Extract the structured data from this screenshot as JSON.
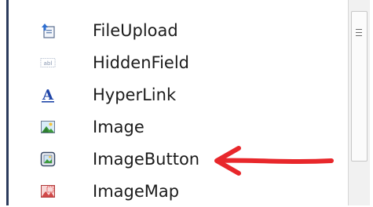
{
  "toolbox": {
    "items": [
      {
        "label": "FileUpload",
        "icon": "file-upload-icon"
      },
      {
        "label": "HiddenField",
        "icon": "hidden-field-icon"
      },
      {
        "label": "HyperLink",
        "icon": "hyperlink-icon"
      },
      {
        "label": "Image",
        "icon": "image-icon"
      },
      {
        "label": "ImageButton",
        "icon": "image-button-icon"
      },
      {
        "label": "ImageMap",
        "icon": "image-map-icon"
      }
    ],
    "hidden_field_glyph": "abl",
    "hyperlink_glyph": "A"
  },
  "annotation": {
    "color": "#e8272b"
  },
  "colors": {
    "border": "#2b3b5c",
    "text": "#1b1b1b",
    "link": "#1f45a8"
  }
}
